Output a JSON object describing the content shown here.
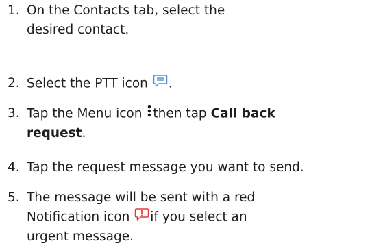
{
  "steps": [
    {
      "number": "1.",
      "text": "On the Contacts tab, select the desired contact."
    },
    {
      "number": "2.",
      "text_before": "Select the PTT icon",
      "icon": "ptt-chat-icon",
      "text_after": "."
    },
    {
      "number": "3.",
      "text_before": "Tap the Menu icon",
      "icon": "more-options-icon",
      "text_middle": "then tap",
      "bold": "Call back request",
      "text_after": "."
    },
    {
      "number": "4.",
      "text": "Tap the request message you want to send."
    },
    {
      "number": "5.",
      "text_before": "The message will be sent with a red Notification icon",
      "icon": "urgent-notification-icon",
      "text_after": "if you select an urgent message."
    }
  ],
  "colors": {
    "text": "#1e1e1e",
    "ptt_icon": "#4a90e2",
    "notification_icon": "#e53935"
  }
}
